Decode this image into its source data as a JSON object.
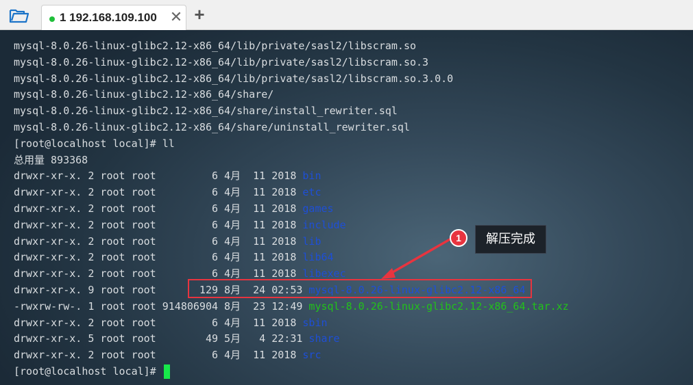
{
  "tabbar": {
    "folder_icon": "folder-open-icon",
    "tab": {
      "status_color": "#1fbf3a",
      "title": "1 192.168.109.100",
      "close": "✕"
    },
    "add": "+"
  },
  "terminal": {
    "colors": {
      "dir": "#1e4fd6",
      "archive": "#22c21a",
      "cursor": "#17e84a"
    },
    "lines": [
      {
        "text": "mysql-8.0.26-linux-glibc2.12-x86_64/lib/private/sasl2/libscram.so"
      },
      {
        "text": "mysql-8.0.26-linux-glibc2.12-x86_64/lib/private/sasl2/libscram.so.3"
      },
      {
        "text": "mysql-8.0.26-linux-glibc2.12-x86_64/lib/private/sasl2/libscram.so.3.0.0"
      },
      {
        "text": "mysql-8.0.26-linux-glibc2.12-x86_64/share/"
      },
      {
        "text": "mysql-8.0.26-linux-glibc2.12-x86_64/share/install_rewriter.sql"
      },
      {
        "text": "mysql-8.0.26-linux-glibc2.12-x86_64/share/uninstall_rewriter.sql"
      },
      {
        "text": "[root@localhost local]# ll"
      },
      {
        "text": "总用量 893368"
      },
      {
        "text": "drwxr-xr-x. 2 root root         6 4月  11 2018 ",
        "name": "bin",
        "color": "blue"
      },
      {
        "text": "drwxr-xr-x. 2 root root         6 4月  11 2018 ",
        "name": "etc",
        "color": "blue"
      },
      {
        "text": "drwxr-xr-x. 2 root root         6 4月  11 2018 ",
        "name": "games",
        "color": "blue"
      },
      {
        "text": "drwxr-xr-x. 2 root root         6 4月  11 2018 ",
        "name": "include",
        "color": "blue"
      },
      {
        "text": "drwxr-xr-x. 2 root root         6 4月  11 2018 ",
        "name": "lib",
        "color": "blue"
      },
      {
        "text": "drwxr-xr-x. 2 root root         6 4月  11 2018 ",
        "name": "lib64",
        "color": "blue"
      },
      {
        "text": "drwxr-xr-x. 2 root root         6 4月  11 2018 ",
        "name": "libexec",
        "color": "blue"
      },
      {
        "text": "drwxr-xr-x. 9 root root       129 8月  24 02:53 ",
        "name": "mysql-8.0.26-linux-glibc2.12-x86_64",
        "color": "blue"
      },
      {
        "text": "-rwxrw-rw-. 1 root root 914806904 8月  23 12:49 ",
        "name": "mysql-8.0.26-linux-glibc2.12-x86_64.tar.xz",
        "color": "green"
      },
      {
        "text": "drwxr-xr-x. 2 root root         6 4月  11 2018 ",
        "name": "sbin",
        "color": "blue"
      },
      {
        "text": "drwxr-xr-x. 5 root root        49 5月   4 22:31 ",
        "name": "share",
        "color": "blue"
      },
      {
        "text": "drwxr-xr-x. 2 root root         6 4月  11 2018 ",
        "name": "src",
        "color": "blue"
      },
      {
        "text": "[root@localhost local]# ",
        "cursor": true
      }
    ]
  },
  "annotation": {
    "badge": "1",
    "label": "解压完成",
    "color": "#e8343f"
  }
}
